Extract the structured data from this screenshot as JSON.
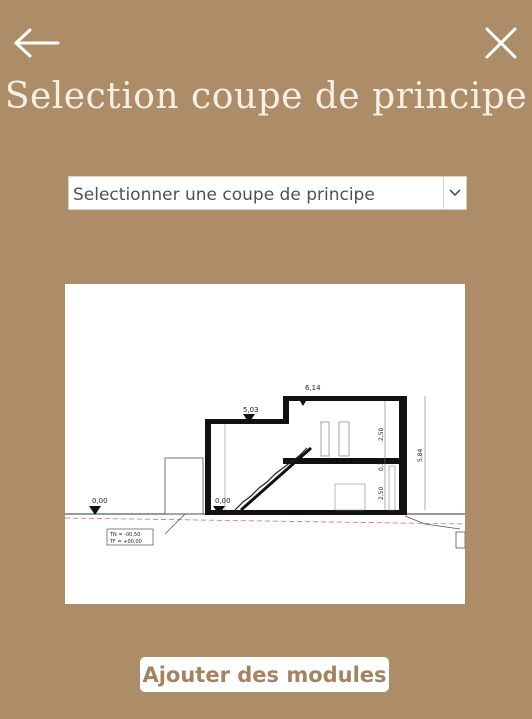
{
  "header": {
    "back_icon": "arrow-left-icon",
    "close_icon": "close-icon",
    "title": "Selection coupe de principe"
  },
  "select": {
    "value": "Selectionner une coupe de principe",
    "chevron_icon": "chevron-down-icon"
  },
  "drawing": {
    "levels": {
      "roof_top": "6,14",
      "roof_low": "5,03",
      "ground_left": "0,00",
      "ground_door": "0,00"
    },
    "heights": {
      "floor2": "2,50",
      "slab": "0,37",
      "floor1": "2,50",
      "total": "5,84"
    },
    "legend": {
      "line1": "TN = -00,50",
      "line2": "TF = +00,00"
    }
  },
  "actions": {
    "add_label": "Ajouter des modules"
  },
  "colors": {
    "background": "#ad8d68",
    "button_text": "#a48363"
  }
}
